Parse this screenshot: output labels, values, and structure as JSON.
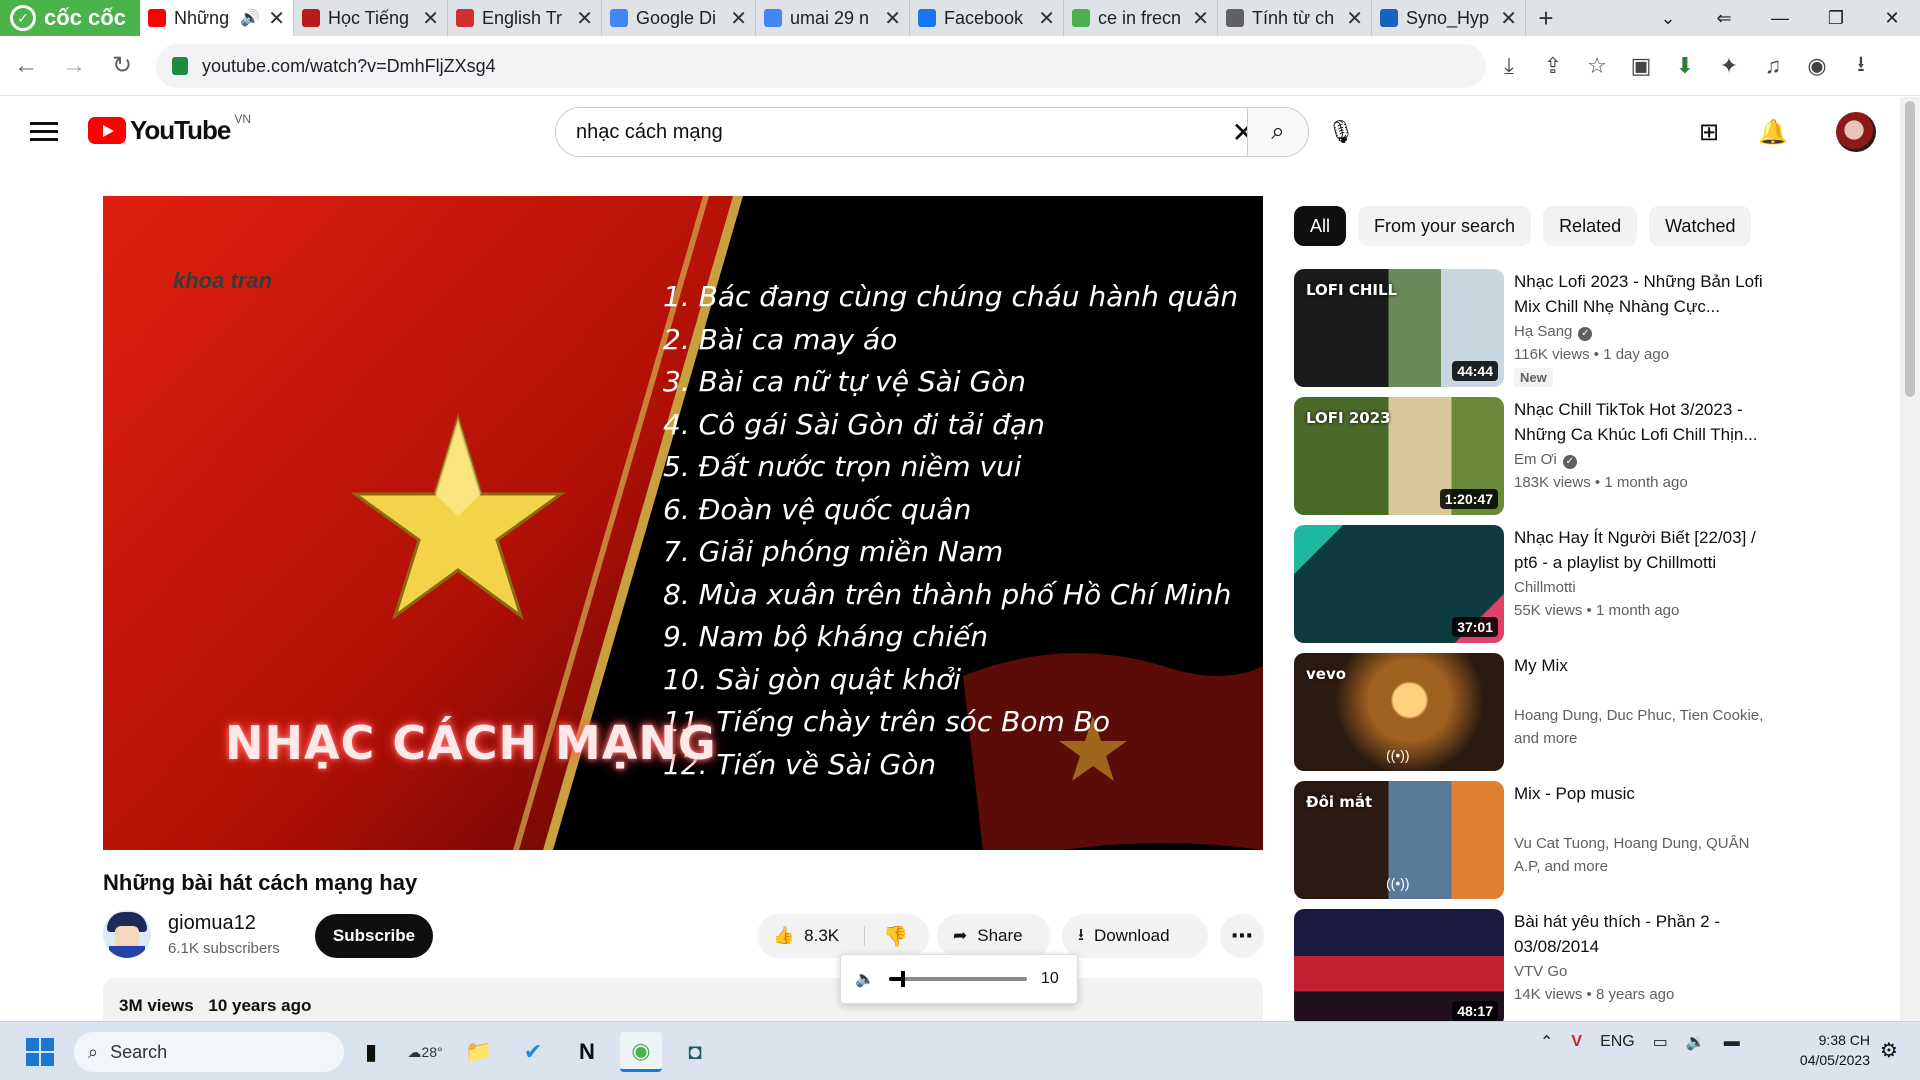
{
  "browser": {
    "coccoc_label": "cốc cốc",
    "tabs": [
      {
        "title": "Những",
        "active": true,
        "fav_color": "#ff0000",
        "fav": "youtube-icon",
        "audio": true
      },
      {
        "title": "Học Tiếng",
        "fav_color": "#b71c1c",
        "fav": "page-icon"
      },
      {
        "title": "English Tr",
        "fav_color": "#d32f2f",
        "fav": "c-icon"
      },
      {
        "title": "Google Di",
        "fav_color": "#4285f4",
        "fav": "translate-icon"
      },
      {
        "title": "umai 29 n",
        "fav_color": "#4285f4",
        "fav": "google-icon"
      },
      {
        "title": "Facebook",
        "fav_color": "#1877f2",
        "fav": "facebook-icon"
      },
      {
        "title": "ce in frecn",
        "fav_color": "#4caf50",
        "fav": "coccoc-search-icon"
      },
      {
        "title": "Tính từ ch",
        "fav_color": "#616161",
        "fav": "globe-icon"
      },
      {
        "title": "Syno_Hyp",
        "fav_color": "#1565c0",
        "fav": "dsn-icon"
      }
    ],
    "url": "youtube.com/watch?v=DmhFljZXsg4"
  },
  "youtube": {
    "logo_text": "YouTube",
    "country": "VN",
    "search_value": "nhạc cách mạng",
    "video": {
      "watermark": "khoa tran",
      "songs": [
        "1. Bác đang cùng chúng cháu hành quân",
        "2. Bài ca may áo",
        "3. Bài ca nữ tự vệ Sài Gòn",
        "4. Cô gái Sài Gòn đi tải đạn",
        "5. Đất nước trọn niềm vui",
        "6. Đoàn vệ quốc quân",
        "7. Giải phóng miền Nam",
        "8. Mùa xuân trên thành phố Hồ Chí Minh",
        "9. Nam bộ kháng chiến",
        "10. Sài gòn quật khởi",
        "11. Tiếng chày trên sóc Bom Bo",
        "12. Tiến về Sài Gòn"
      ],
      "overlay_title": "NHẠC CÁCH MẠNG"
    },
    "title": "Những bài hát cách mạng hay",
    "channel": {
      "name": "giomua12",
      "subs": "6.1K subscribers"
    },
    "subscribe": "Subscribe",
    "likes": "8.3K",
    "share": "Share",
    "download": "Download",
    "views": "3M views",
    "age": "10 years ago",
    "volume": {
      "value": "10",
      "fraction": 0.1
    },
    "chips": [
      "All",
      "From your search",
      "Related",
      "Watched"
    ],
    "recommendations": [
      {
        "title": "Nhạc Lofi 2023 - Những Bản Lofi Mix Chill Nhẹ Nhàng Cực...",
        "channel": "Hạ Sang",
        "verified": true,
        "views": "116K views",
        "age": "1 day ago",
        "duration": "44:44",
        "badge": "New",
        "thumb_text": "LOFI CHILL"
      },
      {
        "title": "Nhạc Chill TikTok Hot 3/2023 - Những Ca Khúc Lofi Chill Thịn...",
        "channel": "Em Ơi",
        "verified": true,
        "views": "183K views",
        "age": "1 month ago",
        "duration": "1:20:47",
        "thumb_text": "LOFI 2023"
      },
      {
        "title": "Nhạc Hay Ít Người Biết [22/03] / pt6 - a playlist by Chillmotti",
        "channel": "Chillmotti",
        "views": "55K views",
        "age": "1 month ago",
        "duration": "37:01"
      },
      {
        "title": "My Mix",
        "channel": "Hoang Dung, Duc Phuc, Tien Cookie,",
        "channel2": "and more",
        "mix": true,
        "thumb_text": "vevo"
      },
      {
        "title": "Mix - Pop music",
        "channel": "Vu Cat Tuong, Hoang Dung, QUÂN",
        "channel2": "A.P, and more",
        "mix": true,
        "thumb_text": "Đôi mắt"
      },
      {
        "title": "Bài hát yêu thích - Phần 2 - 03/08/2014",
        "channel": "VTV Go",
        "views": "14K views",
        "age": "8 years ago",
        "duration": "48:17"
      }
    ]
  },
  "taskbar": {
    "search": "Search",
    "weather": "28°",
    "lang": "ENG",
    "time": "9:38 CH",
    "date": "04/05/2023"
  }
}
